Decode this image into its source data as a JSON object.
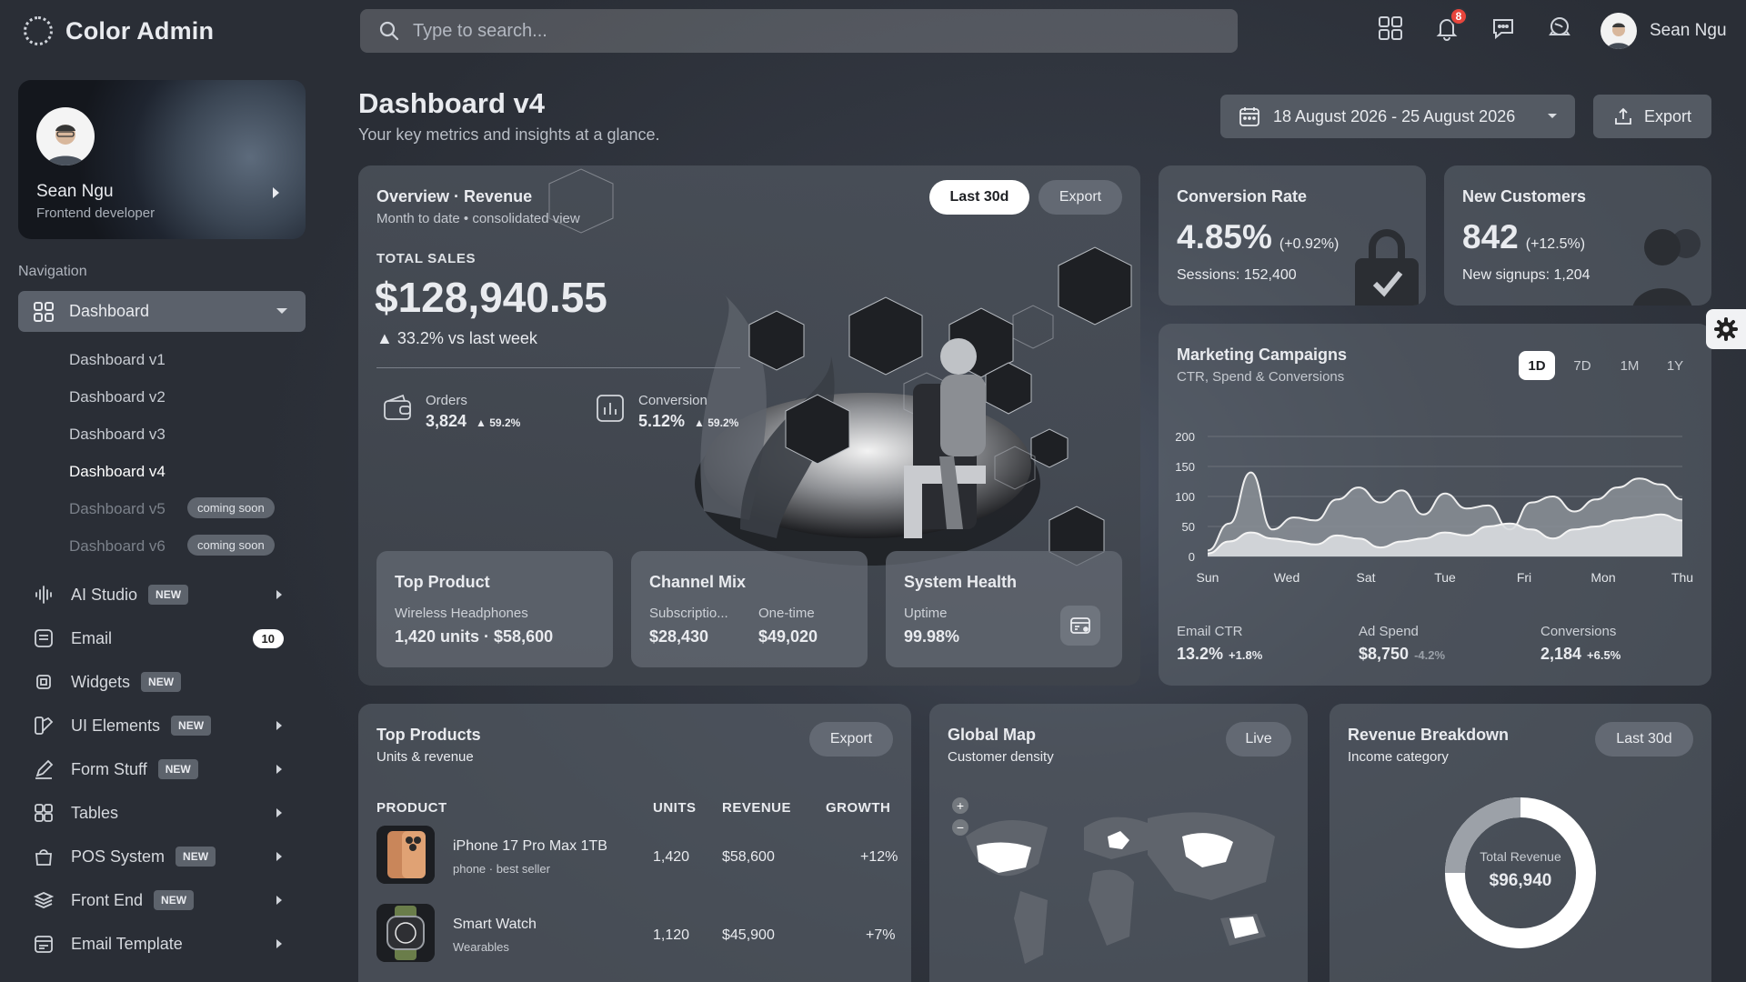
{
  "brand": {
    "name": "Color Admin"
  },
  "search": {
    "placeholder": "Type to search..."
  },
  "topbar": {
    "notifications_count": "8",
    "user_name": "Sean Ngu"
  },
  "profile": {
    "name": "Sean Ngu",
    "role": "Frontend developer"
  },
  "nav": {
    "heading": "Navigation",
    "dashboard": {
      "label": "Dashboard",
      "children": [
        {
          "label": "Dashboard v1"
        },
        {
          "label": "Dashboard v2"
        },
        {
          "label": "Dashboard v3"
        },
        {
          "label": "Dashboard v4",
          "active": true
        },
        {
          "label": "Dashboard v5",
          "badge": "coming soon"
        },
        {
          "label": "Dashboard v6",
          "badge": "coming soon"
        }
      ]
    },
    "items": [
      {
        "label": "AI Studio",
        "badge": "NEW"
      },
      {
        "label": "Email",
        "count": "10"
      },
      {
        "label": "Widgets",
        "badge": "NEW"
      },
      {
        "label": "UI Elements",
        "badge": "NEW"
      },
      {
        "label": "Form Stuff",
        "badge": "NEW"
      },
      {
        "label": "Tables"
      },
      {
        "label": "POS System",
        "badge": "NEW"
      },
      {
        "label": "Front End",
        "badge": "NEW"
      },
      {
        "label": "Email Template"
      }
    ]
  },
  "page": {
    "title": "Dashboard v4",
    "subtitle": "Your key metrics and insights at a glance.",
    "date_range": "18 August 2026 - 25 August 2026",
    "export_label": "Export"
  },
  "overview": {
    "title": "Overview · Revenue",
    "subtitle": "Month to date • consolidated view",
    "btn_range": "Last 30d",
    "btn_export": "Export",
    "total_label": "TOTAL SALES",
    "total_value": "$128,940.55",
    "delta": "▲ 33.2% vs last week",
    "orders": {
      "label": "Orders",
      "value": "3,824",
      "change": "▲ 59.2%"
    },
    "conversion": {
      "label": "Conversion",
      "value": "5.12%",
      "change": "▲ 59.2%"
    },
    "top_product": {
      "title": "Top Product",
      "name": "Wireless Headphones",
      "value": "1,420 units · $58,600"
    },
    "channel_mix": {
      "title": "Channel Mix",
      "a_label": "Subscriptio...",
      "a_value": "$28,430",
      "b_label": "One-time",
      "b_value": "$49,020"
    },
    "system_health": {
      "title": "System Health",
      "label": "Uptime",
      "value": "99.98%"
    }
  },
  "conversion_rate": {
    "title": "Conversion Rate",
    "value": "4.85%",
    "change": "(+0.92%)",
    "sessions": "Sessions: 152,400"
  },
  "new_customers": {
    "title": "New Customers",
    "value": "842",
    "change": "(+12.5%)",
    "signups": "New signups: 1,204"
  },
  "marketing": {
    "title": "Marketing Campaigns",
    "subtitle": "CTR, Spend & Conversions",
    "timeframes": [
      "1D",
      "7D",
      "1M",
      "1Y"
    ],
    "stats": [
      {
        "label": "Email CTR",
        "value": "13.2%",
        "change": "+1.8%"
      },
      {
        "label": "Ad Spend",
        "value": "$8,750",
        "change": "-4.2%"
      },
      {
        "label": "Conversions",
        "value": "2,184",
        "change": "+6.5%"
      }
    ]
  },
  "chart_data": {
    "type": "area",
    "categories": [
      "Sun",
      "Wed",
      "Sat",
      "Tue",
      "Fri",
      "Mon",
      "Thu"
    ],
    "ylim": [
      0,
      200
    ],
    "yticks": [
      0,
      50,
      100,
      150,
      200
    ],
    "series": [
      {
        "values": [
          10,
          55,
          140,
          45,
          65,
          60,
          95,
          115,
          90,
          110,
          70,
          105,
          80,
          85,
          45,
          90,
          100,
          75,
          95,
          115,
          130,
          120,
          95
        ]
      },
      {
        "values": [
          5,
          25,
          40,
          30,
          25,
          20,
          35,
          30,
          15,
          25,
          30,
          40,
          35,
          50,
          55,
          45,
          30,
          45,
          50,
          60,
          65,
          70,
          60
        ]
      }
    ],
    "grid": true
  },
  "top_products": {
    "title": "Top Products",
    "subtitle": "Units & revenue",
    "export_label": "Export",
    "columns": [
      "PRODUCT",
      "UNITS",
      "REVENUE",
      "GROWTH"
    ],
    "rows": [
      {
        "name": "iPhone 17 Pro Max 1TB",
        "category": "phone · best seller",
        "units": "1,420",
        "revenue": "$58,600",
        "growth": "+12%"
      },
      {
        "name": "Smart Watch",
        "category": "Wearables",
        "units": "1,120",
        "revenue": "$45,900",
        "growth": "+7%"
      }
    ]
  },
  "global_map": {
    "title": "Global Map",
    "subtitle": "Customer density",
    "badge": "Live"
  },
  "revenue_breakdown": {
    "title": "Revenue Breakdown",
    "subtitle": "Income category",
    "btn": "Last 30d",
    "center_label": "Total Revenue",
    "center_value": "$96,940",
    "subscriptions_share": 0.25
  }
}
